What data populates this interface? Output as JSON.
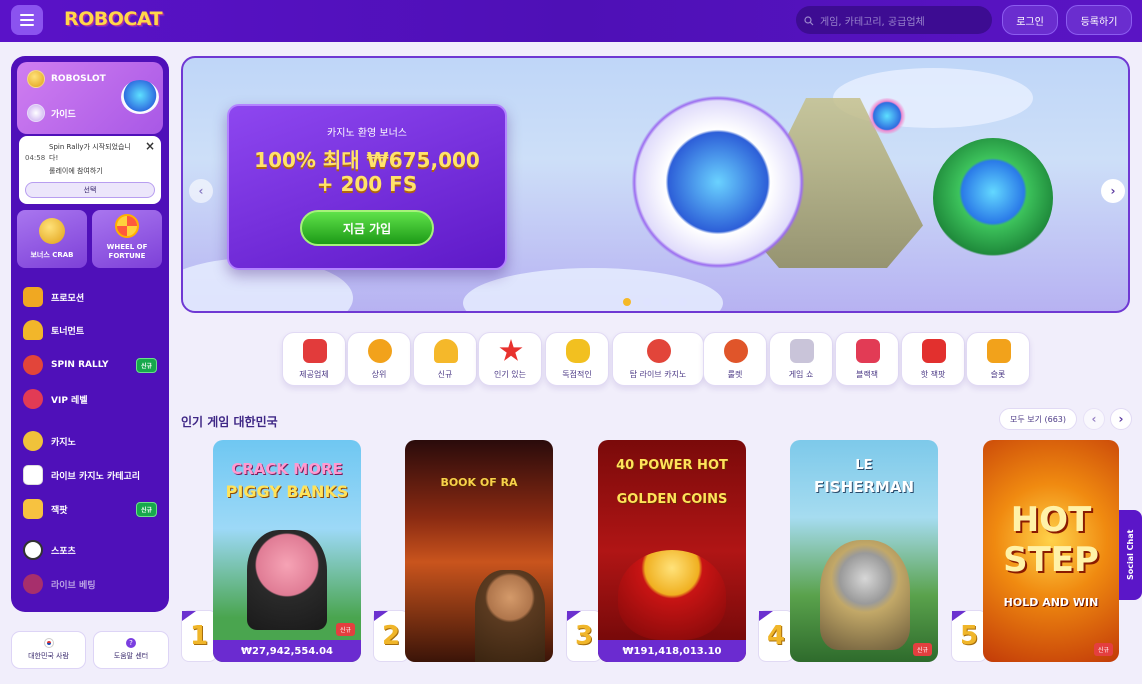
{
  "header": {
    "logo_text": "ROBOCAT",
    "search_placeholder": "게임, 카테고리, 공급업체",
    "login_label": "로그인",
    "register_label": "등록하기"
  },
  "sidebar": {
    "top_items": [
      {
        "label": "ROBOSLOT"
      },
      {
        "label": "가이드"
      }
    ],
    "notice": {
      "time": "04:58",
      "line1": "Spin Rally가 시작되었습니",
      "line2": "다!",
      "line3": "롤레이에 참여하기",
      "button_label": "선택"
    },
    "cards": [
      {
        "label": "보너스 CRAB"
      },
      {
        "label": "WHEEL OF FORTUNE"
      }
    ],
    "nav": [
      {
        "label": "프로모션",
        "badge": ""
      },
      {
        "label": "토너먼트",
        "badge": ""
      },
      {
        "label": "SPIN RALLY",
        "badge": "신규"
      },
      {
        "label": "VIP 레벨",
        "badge": ""
      },
      {
        "label": "카지노",
        "badge": ""
      },
      {
        "label": "라이브 카지노 카테고리",
        "badge": ""
      },
      {
        "label": "잭팟",
        "badge": "신규"
      },
      {
        "label": "스포츠",
        "badge": ""
      },
      {
        "label": "라이브 베팅",
        "badge": ""
      }
    ],
    "footer": [
      {
        "label": "대한민국 사람"
      },
      {
        "label": "도움말 센터"
      }
    ]
  },
  "hero": {
    "subtitle": "카지노 환영 보너스",
    "headline1": "100% 최대 ₩675,000",
    "headline2": "+ 200 FS",
    "cta_label": "지금 가입",
    "slide_count": 4,
    "active_slide": 1
  },
  "categories": [
    {
      "label": "제공업체",
      "color": "#e23b3b"
    },
    {
      "label": "상위",
      "color": "#f2a21b"
    },
    {
      "label": "신규",
      "color": "#f5b82a"
    },
    {
      "label": "인기 있는",
      "color": "#e8322e"
    },
    {
      "label": "독점적인",
      "color": "#f2c020"
    },
    {
      "label": "탑 라이브 카지노",
      "color": "#e2453a"
    },
    {
      "label": "룰렛",
      "color": "#e0552a"
    },
    {
      "label": "게임 쇼",
      "color": "#c9c4d9"
    },
    {
      "label": "블랙잭",
      "color": "#e23b55"
    },
    {
      "label": "핫 잭팟",
      "color": "#e2302e"
    },
    {
      "label": "슬롯",
      "color": "#f2a21b"
    }
  ],
  "popular": {
    "title": "인기 게임 대한민국",
    "see_all_label": "모두 보기 (663)",
    "games": [
      {
        "rank": "1",
        "title1": "CRACK MORE",
        "title2": "PIGGY BANKS",
        "price": "₩27,942,554.04",
        "tag": "신규"
      },
      {
        "rank": "2",
        "title1": "BOOK OF RA",
        "title2": "",
        "price": "",
        "tag": ""
      },
      {
        "rank": "3",
        "title1": "40 POWER HOT",
        "title2": "GOLDEN COINS",
        "price": "₩191,418,013.10",
        "tag": ""
      },
      {
        "rank": "4",
        "title1": "LE",
        "title2": "FISHERMAN",
        "price": "",
        "tag": "신규"
      },
      {
        "rank": "5",
        "title1": "HOT",
        "title2": "STEP",
        "title3": "HOLD AND WIN",
        "price": "",
        "tag": "신규"
      }
    ]
  },
  "social_chat_label": "Social Chat"
}
